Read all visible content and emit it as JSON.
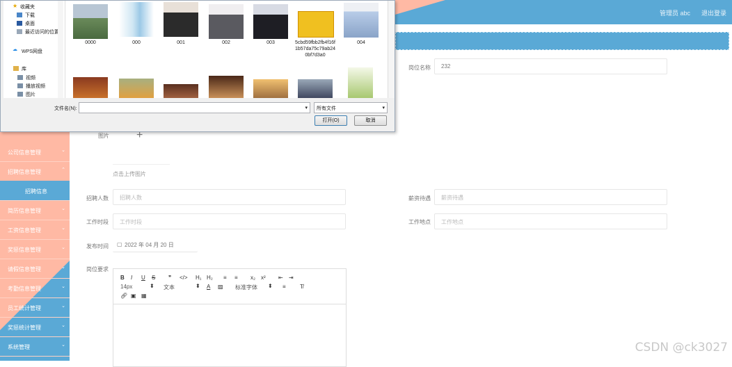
{
  "header": {
    "admin_label": "管理员 abc",
    "logout_label": "退出登录"
  },
  "sidebar": {
    "items": [
      {
        "label": "公司信息管理"
      },
      {
        "label": "招聘信息管理"
      },
      {
        "label": "招聘信息"
      },
      {
        "label": "简历信息管理"
      },
      {
        "label": "工资信息管理"
      },
      {
        "label": "奖惩信息管理"
      },
      {
        "label": "请假信息管理"
      },
      {
        "label": "考勤信息管理"
      },
      {
        "label": "员工统计管理"
      },
      {
        "label": "奖惩统计管理"
      },
      {
        "label": "系统管理"
      }
    ]
  },
  "form": {
    "position_name_label": "岗位名称",
    "position_name_value": "232",
    "image_label": "图片",
    "upload_hint": "点击上传图片",
    "headcount_label": "招聘人数",
    "headcount_placeholder": "招聘人数",
    "salary_label": "薪资待遇",
    "salary_placeholder": "薪资待遇",
    "work_hours_label": "工作时段",
    "work_hours_placeholder": "工作时段",
    "work_location_label": "工作地点",
    "work_location_placeholder": "工作地点",
    "publish_time_label": "发布时间",
    "publish_time_value": "2022 年 04 月 20 日",
    "requirements_label": "岗位要求"
  },
  "editor": {
    "row1": [
      "B",
      "I",
      "U",
      "S",
      "❞",
      "</>",
      "H₁",
      "H₂",
      "≡",
      "≡",
      "x₂",
      "x²",
      "⇤",
      "⇥"
    ],
    "font_size": "14px",
    "text_type": "文本",
    "font_family": "标准字体"
  },
  "dialog": {
    "nav_items": [
      "收藏夹",
      "下载",
      "桌面",
      "最近访问的位置",
      "WPS网盘",
      "库",
      "视频",
      "图片"
    ],
    "nav_items_extra": [
      "播放视频"
    ],
    "files": [
      {
        "name": "0000"
      },
      {
        "name": "000"
      },
      {
        "name": "001"
      },
      {
        "name": "002"
      },
      {
        "name": "003"
      },
      {
        "name": "5cbd59fbb2fb4f16f1b57da75c79ab240bf7d3a0"
      },
      {
        "name": "004"
      }
    ],
    "filename_label": "文件名(N):",
    "filetype_value": "所有文件",
    "open_button": "打开(O)",
    "cancel_button": "取消"
  },
  "watermark": "CSDN @ck3027"
}
